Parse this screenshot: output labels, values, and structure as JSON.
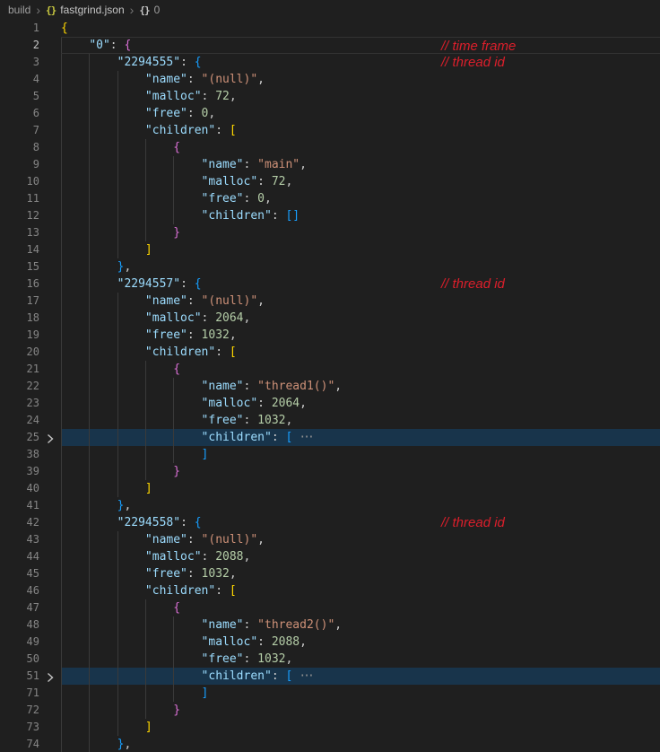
{
  "breadcrumb": {
    "separator": "›",
    "items": [
      {
        "label": "build"
      },
      {
        "label": "fastgrind.json",
        "icon": "{}"
      },
      {
        "label": "0",
        "icon": "{}"
      }
    ]
  },
  "editor": {
    "fold_placeholder": "···",
    "colors": {
      "background": "#1f1f1f",
      "foreground": "#cccccc",
      "line_number": "#858585",
      "line_number_active": "#c6c6c6",
      "key": "#9cdcfe",
      "string": "#ce9178",
      "number": "#b5cea8",
      "bracket_gold": "#ffd700",
      "bracket_pink": "#da70d6",
      "bracket_blue": "#179fff",
      "indent_guide": "#3a3a3a",
      "folded_line_background": "#18344b",
      "active_line_border": "#333333",
      "annotation_red": "#dc1f2b",
      "json_icon_yellow": "#cbcb41",
      "fold_chevron": "#c5c5c5"
    },
    "lines": [
      {
        "n": 1,
        "indent": 0,
        "tokens": [
          [
            "b1",
            "{"
          ]
        ]
      },
      {
        "n": 2,
        "indent": 1,
        "active": true,
        "annotation": "// time frame",
        "tokens": [
          [
            "key",
            "\"0\""
          ],
          [
            "punc",
            ": "
          ],
          [
            "b2",
            "{"
          ]
        ]
      },
      {
        "n": 3,
        "indent": 2,
        "annotation": "// thread id",
        "tokens": [
          [
            "key",
            "\"2294555\""
          ],
          [
            "punc",
            ": "
          ],
          [
            "b3",
            "{"
          ]
        ]
      },
      {
        "n": 4,
        "indent": 3,
        "tokens": [
          [
            "key",
            "\"name\""
          ],
          [
            "punc",
            ": "
          ],
          [
            "str",
            "\"(null)\""
          ],
          [
            "punc",
            ","
          ]
        ]
      },
      {
        "n": 5,
        "indent": 3,
        "tokens": [
          [
            "key",
            "\"malloc\""
          ],
          [
            "punc",
            ": "
          ],
          [
            "num",
            "72"
          ],
          [
            "punc",
            ","
          ]
        ]
      },
      {
        "n": 6,
        "indent": 3,
        "tokens": [
          [
            "key",
            "\"free\""
          ],
          [
            "punc",
            ": "
          ],
          [
            "num",
            "0"
          ],
          [
            "punc",
            ","
          ]
        ]
      },
      {
        "n": 7,
        "indent": 3,
        "tokens": [
          [
            "key",
            "\"children\""
          ],
          [
            "punc",
            ": "
          ],
          [
            "b1",
            "["
          ]
        ]
      },
      {
        "n": 8,
        "indent": 4,
        "tokens": [
          [
            "b2",
            "{"
          ]
        ]
      },
      {
        "n": 9,
        "indent": 5,
        "tokens": [
          [
            "key",
            "\"name\""
          ],
          [
            "punc",
            ": "
          ],
          [
            "str",
            "\"main\""
          ],
          [
            "punc",
            ","
          ]
        ]
      },
      {
        "n": 10,
        "indent": 5,
        "tokens": [
          [
            "key",
            "\"malloc\""
          ],
          [
            "punc",
            ": "
          ],
          [
            "num",
            "72"
          ],
          [
            "punc",
            ","
          ]
        ]
      },
      {
        "n": 11,
        "indent": 5,
        "tokens": [
          [
            "key",
            "\"free\""
          ],
          [
            "punc",
            ": "
          ],
          [
            "num",
            "0"
          ],
          [
            "punc",
            ","
          ]
        ]
      },
      {
        "n": 12,
        "indent": 5,
        "tokens": [
          [
            "key",
            "\"children\""
          ],
          [
            "punc",
            ": "
          ],
          [
            "b3",
            "[]"
          ]
        ]
      },
      {
        "n": 13,
        "indent": 4,
        "tokens": [
          [
            "b2",
            "}"
          ]
        ]
      },
      {
        "n": 14,
        "indent": 3,
        "tokens": [
          [
            "b1",
            "]"
          ]
        ]
      },
      {
        "n": 15,
        "indent": 2,
        "tokens": [
          [
            "b3",
            "}"
          ],
          [
            "punc",
            ","
          ]
        ]
      },
      {
        "n": 16,
        "indent": 2,
        "annotation": "// thread id",
        "tokens": [
          [
            "key",
            "\"2294557\""
          ],
          [
            "punc",
            ": "
          ],
          [
            "b3",
            "{"
          ]
        ]
      },
      {
        "n": 17,
        "indent": 3,
        "tokens": [
          [
            "key",
            "\"name\""
          ],
          [
            "punc",
            ": "
          ],
          [
            "str",
            "\"(null)\""
          ],
          [
            "punc",
            ","
          ]
        ]
      },
      {
        "n": 18,
        "indent": 3,
        "tokens": [
          [
            "key",
            "\"malloc\""
          ],
          [
            "punc",
            ": "
          ],
          [
            "num",
            "2064"
          ],
          [
            "punc",
            ","
          ]
        ]
      },
      {
        "n": 19,
        "indent": 3,
        "tokens": [
          [
            "key",
            "\"free\""
          ],
          [
            "punc",
            ": "
          ],
          [
            "num",
            "1032"
          ],
          [
            "punc",
            ","
          ]
        ]
      },
      {
        "n": 20,
        "indent": 3,
        "tokens": [
          [
            "key",
            "\"children\""
          ],
          [
            "punc",
            ": "
          ],
          [
            "b1",
            "["
          ]
        ]
      },
      {
        "n": 21,
        "indent": 4,
        "tokens": [
          [
            "b2",
            "{"
          ]
        ]
      },
      {
        "n": 22,
        "indent": 5,
        "tokens": [
          [
            "key",
            "\"name\""
          ],
          [
            "punc",
            ": "
          ],
          [
            "str",
            "\"thread1()\""
          ],
          [
            "punc",
            ","
          ]
        ]
      },
      {
        "n": 23,
        "indent": 5,
        "tokens": [
          [
            "key",
            "\"malloc\""
          ],
          [
            "punc",
            ": "
          ],
          [
            "num",
            "2064"
          ],
          [
            "punc",
            ","
          ]
        ]
      },
      {
        "n": 24,
        "indent": 5,
        "tokens": [
          [
            "key",
            "\"free\""
          ],
          [
            "punc",
            ": "
          ],
          [
            "num",
            "1032"
          ],
          [
            "punc",
            ","
          ]
        ]
      },
      {
        "n": 25,
        "indent": 5,
        "folded": true,
        "tokens": [
          [
            "key",
            "\"children\""
          ],
          [
            "punc",
            ": "
          ],
          [
            "b3",
            "["
          ]
        ]
      },
      {
        "n": 38,
        "indent": 5,
        "tokens": [
          [
            "b3",
            "]"
          ]
        ]
      },
      {
        "n": 39,
        "indent": 4,
        "tokens": [
          [
            "b2",
            "}"
          ]
        ]
      },
      {
        "n": 40,
        "indent": 3,
        "tokens": [
          [
            "b1",
            "]"
          ]
        ]
      },
      {
        "n": 41,
        "indent": 2,
        "tokens": [
          [
            "b3",
            "}"
          ],
          [
            "punc",
            ","
          ]
        ]
      },
      {
        "n": 42,
        "indent": 2,
        "annotation": "// thread id",
        "tokens": [
          [
            "key",
            "\"2294558\""
          ],
          [
            "punc",
            ": "
          ],
          [
            "b3",
            "{"
          ]
        ]
      },
      {
        "n": 43,
        "indent": 3,
        "tokens": [
          [
            "key",
            "\"name\""
          ],
          [
            "punc",
            ": "
          ],
          [
            "str",
            "\"(null)\""
          ],
          [
            "punc",
            ","
          ]
        ]
      },
      {
        "n": 44,
        "indent": 3,
        "tokens": [
          [
            "key",
            "\"malloc\""
          ],
          [
            "punc",
            ": "
          ],
          [
            "num",
            "2088"
          ],
          [
            "punc",
            ","
          ]
        ]
      },
      {
        "n": 45,
        "indent": 3,
        "tokens": [
          [
            "key",
            "\"free\""
          ],
          [
            "punc",
            ": "
          ],
          [
            "num",
            "1032"
          ],
          [
            "punc",
            ","
          ]
        ]
      },
      {
        "n": 46,
        "indent": 3,
        "tokens": [
          [
            "key",
            "\"children\""
          ],
          [
            "punc",
            ": "
          ],
          [
            "b1",
            "["
          ]
        ]
      },
      {
        "n": 47,
        "indent": 4,
        "tokens": [
          [
            "b2",
            "{"
          ]
        ]
      },
      {
        "n": 48,
        "indent": 5,
        "tokens": [
          [
            "key",
            "\"name\""
          ],
          [
            "punc",
            ": "
          ],
          [
            "str",
            "\"thread2()\""
          ],
          [
            "punc",
            ","
          ]
        ]
      },
      {
        "n": 49,
        "indent": 5,
        "tokens": [
          [
            "key",
            "\"malloc\""
          ],
          [
            "punc",
            ": "
          ],
          [
            "num",
            "2088"
          ],
          [
            "punc",
            ","
          ]
        ]
      },
      {
        "n": 50,
        "indent": 5,
        "tokens": [
          [
            "key",
            "\"free\""
          ],
          [
            "punc",
            ": "
          ],
          [
            "num",
            "1032"
          ],
          [
            "punc",
            ","
          ]
        ]
      },
      {
        "n": 51,
        "indent": 5,
        "folded": true,
        "tokens": [
          [
            "key",
            "\"children\""
          ],
          [
            "punc",
            ": "
          ],
          [
            "b3",
            "["
          ]
        ]
      },
      {
        "n": 71,
        "indent": 5,
        "tokens": [
          [
            "b3",
            "]"
          ]
        ]
      },
      {
        "n": 72,
        "indent": 4,
        "tokens": [
          [
            "b2",
            "}"
          ]
        ]
      },
      {
        "n": 73,
        "indent": 3,
        "tokens": [
          [
            "b1",
            "]"
          ]
        ]
      },
      {
        "n": 74,
        "indent": 2,
        "tokens": [
          [
            "b3",
            "}"
          ],
          [
            "punc",
            ","
          ]
        ]
      }
    ]
  }
}
